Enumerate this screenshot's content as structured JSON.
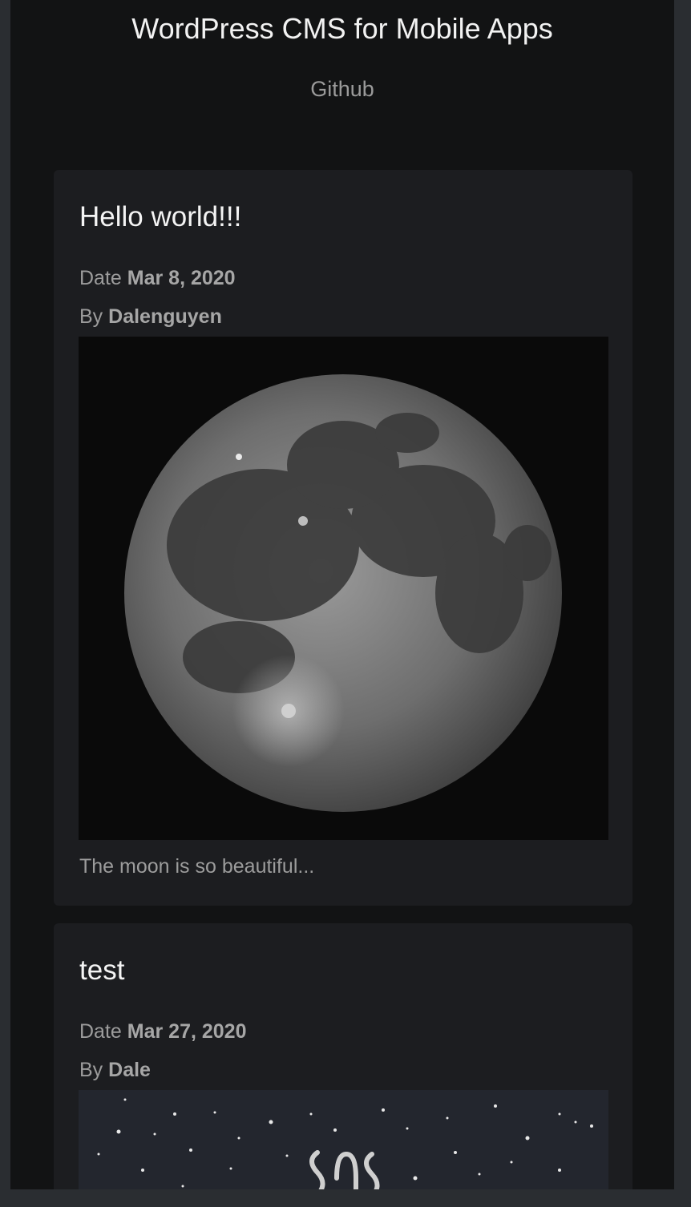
{
  "header": {
    "title": "WordPress CMS for Mobile Apps",
    "link_label": "Github"
  },
  "posts": [
    {
      "title": "Hello world!!!",
      "date_label": "Date",
      "date": "Mar 8, 2020",
      "author_label": "By",
      "author": "Dalenguyen",
      "image": "full-moon-photo",
      "excerpt": "The moon is so beautiful..."
    },
    {
      "title": "test",
      "date_label": "Date",
      "date": "Mar 27, 2020",
      "author_label": "By",
      "author": "Dale",
      "image": "starry-night-illustration"
    }
  ],
  "colors": {
    "page_bg": "#121314",
    "card_bg": "#1c1d20",
    "title_text": "#f2f2f2",
    "muted_text": "#9c9c9c"
  }
}
